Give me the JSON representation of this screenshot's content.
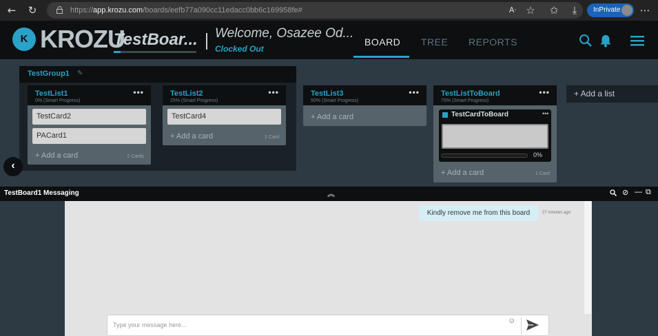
{
  "browser": {
    "url_prefix": "https://",
    "url_host": "app.krozu.com",
    "url_path": "/boards/eefb77a090cc11edacc0bb6c169958fe#",
    "inprivate_label": "InPrivate",
    "icons": [
      "back-icon",
      "refresh-icon",
      "lock-icon",
      "read-aloud-icon",
      "favorite-add-icon",
      "favorites-icon",
      "downloads-icon",
      "more-icon"
    ]
  },
  "header": {
    "logo_mark": "K",
    "logo_text": "KROZU",
    "board_title": "TestBoar...",
    "board_progress": 0.08,
    "welcome": "Welcome, Osazee Od...",
    "clock_status": "Clocked Out",
    "tabs": [
      {
        "label": "BOARD",
        "active": true
      },
      {
        "label": "TREE",
        "active": false
      },
      {
        "label": "REPORTS",
        "active": false
      }
    ],
    "accent_color": "#2aa1c7"
  },
  "board": {
    "group": {
      "title": "TestGroup1"
    },
    "lists": [
      {
        "title": "TestList1",
        "progress": "0% (Smart Progress)",
        "cards": [
          "TestCard2",
          "PACard1"
        ],
        "add_label": "+ Add a card",
        "count": "2 Cards"
      },
      {
        "title": "TestList2",
        "progress": "25% (Smart Progress)",
        "cards": [
          "TestCard4"
        ],
        "add_label": "+ Add a card",
        "count": "1 Card"
      },
      {
        "title": "TestList3",
        "progress": "50% (Smart Progress)",
        "cards": [],
        "add_label": "+ Add a card",
        "count": ""
      },
      {
        "title": "TestListToBoard",
        "progress": "75% (Smart Progress)",
        "add_label": "+ Add a card",
        "count": "1 Card",
        "rich_card": {
          "title": "TestCardToBoard",
          "progress_value": 0,
          "progress_label": "0%"
        }
      }
    ],
    "add_list_label": "+ Add a list",
    "list_menu": "•••"
  },
  "messaging": {
    "title": "TestBoard1 Messaging",
    "messages": [
      {
        "text": "Kindly remove me from this board",
        "time": "27 minutes ago"
      }
    ],
    "composer_placeholder": "Type your message here..."
  }
}
